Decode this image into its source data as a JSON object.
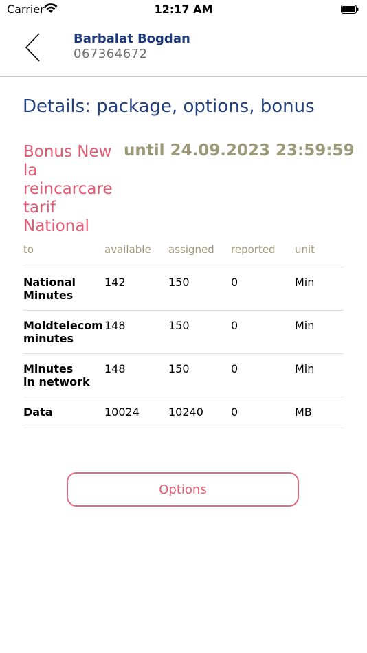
{
  "status_bar": {
    "carrier": "Carrier",
    "time": "12:17 AM"
  },
  "header": {
    "name": "Barbalat Bogdan",
    "phone": "067364672"
  },
  "section_title": "Details: package, options, bonus",
  "bonus": {
    "name": "Bonus New la reincarcare tarif National",
    "until": "until 24.09.2023 23:59:59"
  },
  "table": {
    "headers": [
      "to",
      "available",
      "assigned",
      "reported",
      "unit"
    ],
    "rows": [
      {
        "name": "National\nMinutes",
        "available": "142",
        "assigned": "150",
        "reported": "0",
        "unit": "Min"
      },
      {
        "name": "Moldtelecom\nminutes",
        "available": "148",
        "assigned": "150",
        "reported": "0",
        "unit": "Min"
      },
      {
        "name": "Minutes\nin network",
        "available": "148",
        "assigned": "150",
        "reported": "0",
        "unit": "Min"
      },
      {
        "name": "Data",
        "available": "10024",
        "assigned": "10240",
        "reported": "0",
        "unit": "MB"
      }
    ]
  },
  "options_label": "Options",
  "colors": {
    "title_blue": "#23407e",
    "accent_pink": "#e15b73",
    "olive": "#9c9a78"
  },
  "icons": {
    "back": "chevron-left-icon",
    "wifi": "wifi-icon",
    "battery": "battery-icon"
  }
}
